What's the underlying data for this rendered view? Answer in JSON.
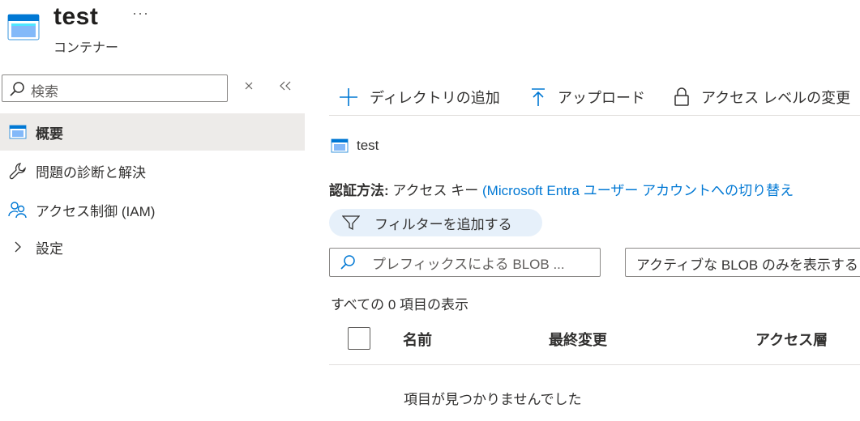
{
  "header": {
    "title": "test",
    "more_label": "···",
    "subtitle": "コンテナー",
    "icon": "container-icon"
  },
  "sidebar": {
    "search_placeholder": "検索",
    "clear_label": "×",
    "collapse_label": "«",
    "items": [
      {
        "label": "概要",
        "icon": "overview-icon",
        "selected": true
      },
      {
        "label": "問題の診断と解決",
        "icon": "wrench-icon"
      },
      {
        "label": "アクセス制御 (IAM)",
        "icon": "people-icon"
      },
      {
        "label": "設定",
        "icon": "chevron-right-icon"
      }
    ]
  },
  "toolbar": {
    "add_directory": "ディレクトリの追加",
    "upload": "アップロード",
    "access_level": "アクセス レベルの変更"
  },
  "breadcrumb": {
    "label": "test"
  },
  "auth": {
    "label": "認証方法:",
    "value": "アクセス キー",
    "switch_link": "(Microsoft Entra ユーザー アカウントへの切り替え"
  },
  "filter": {
    "add_filter": "フィルターを追加する"
  },
  "search": {
    "prefix_placeholder": "プレフィックスによる BLOB ...",
    "active_blob_option": "アクティブな BLOB のみを表示する"
  },
  "list": {
    "count_text": "すべての 0 項目の表示",
    "columns": [
      "名前",
      "最終変更",
      "アクセス層"
    ],
    "empty_text": "項目が見つかりませんでした"
  },
  "colors": {
    "accent": "#0078d4",
    "selected_bg": "#edebe9",
    "pill_bg": "#e6f0fa"
  }
}
